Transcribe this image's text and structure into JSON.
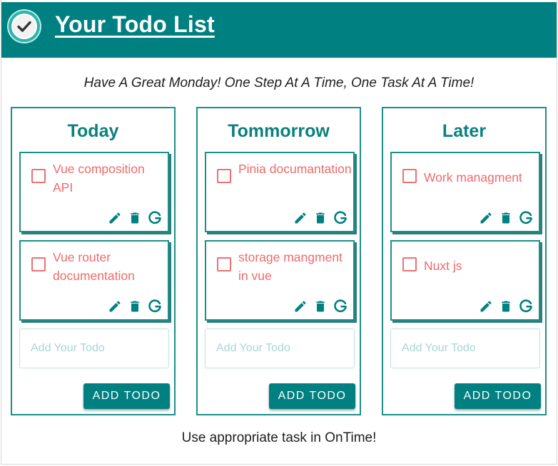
{
  "header": {
    "title": "Your Todo List",
    "logo_icon": "checkmark-circle-icon"
  },
  "tagline": "Have A Great Monday! One Step At A Time, One Task At A Time!",
  "columns": [
    {
      "title": "Today",
      "todos": [
        {
          "text": "Vue composition API",
          "checked": false
        },
        {
          "text": "Vue router documentation",
          "checked": false
        }
      ],
      "input_placeholder": "Add Your Todo",
      "add_button_label": "ADD TODO"
    },
    {
      "title": "Tommorrow",
      "todos": [
        {
          "text": "Pinia documantation",
          "checked": false
        },
        {
          "text": "storage mangment in vue",
          "checked": false
        }
      ],
      "input_placeholder": "Add Your Todo",
      "add_button_label": "ADD TODO"
    },
    {
      "title": "Later",
      "todos": [
        {
          "text": "Work managment",
          "checked": false
        },
        {
          "text": "Nuxt js",
          "checked": false
        }
      ],
      "input_placeholder": "Add Your Todo",
      "add_button_label": "ADD TODO"
    }
  ],
  "todo_actions": [
    "edit-pencil-icon",
    "delete-trash-icon",
    "google-g-icon"
  ],
  "footer": "Use appropriate task in OnTime!",
  "colors": {
    "primary": "#008080",
    "todo_text": "#ee6b6b",
    "card_border": "#1c8f8a",
    "placeholder": "#a9d6d2"
  }
}
